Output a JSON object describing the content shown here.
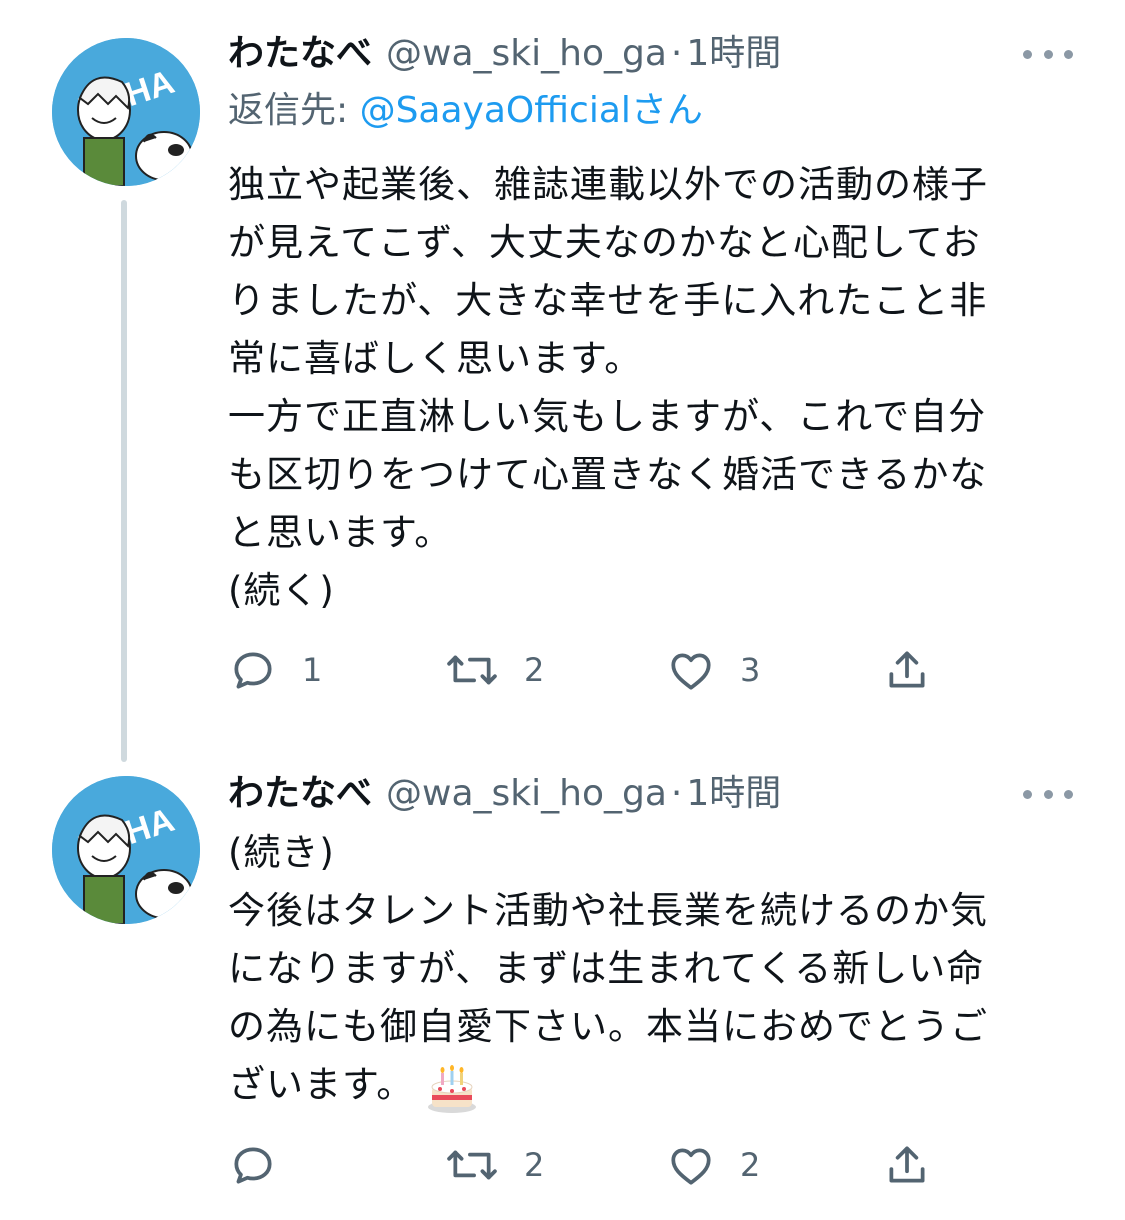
{
  "tweets": [
    {
      "display_name": "わたなべ",
      "handle": "@wa_ski_ho_ga",
      "separator": "·",
      "time": "1時間",
      "reply_prefix": "返信先: ",
      "reply_mention": "@SaayaOfficial",
      "reply_suffix": "さん",
      "lines": [
        "独立や起業後、雑誌連載以外での活動の様子",
        "が見えてこず、大丈夫なのかなと心配してお",
        "りましたが、大きな幸せを手に入れたこと非",
        "常に喜ばしく思います。",
        "一方で正直淋しい気もしますが、これで自分",
        "も区切りをつけて心置きなく婚活できるかな",
        "と思います。",
        "(続く)"
      ],
      "reply_count": "1",
      "retweet_count": "2",
      "like_count": "3",
      "avatar_text": "HAHA"
    },
    {
      "display_name": "わたなべ",
      "handle": "@wa_ski_ho_ga",
      "separator": "·",
      "time": "1時間",
      "lines": [
        "(続き)",
        "今後はタレント活動や社長業を続けるのか気",
        "になりますが、まずは生まれてくる新しい命",
        "の為にも御自愛下さい。本当におめでとうご",
        "ざいます。"
      ],
      "reply_count": "",
      "retweet_count": "2",
      "like_count": "2",
      "avatar_text": "HAHA"
    }
  ],
  "colors": {
    "text": "#0f1419",
    "secondary": "#536471",
    "link": "#1d9bf0",
    "thread_line": "#cfd9de",
    "avatar_bg": "#49a9dc"
  },
  "icons": {
    "reply": "speech-bubble-icon",
    "retweet": "retweet-arrows-icon",
    "like": "heart-icon",
    "share": "share-upload-icon",
    "more": "more-dots-icon",
    "emoji": "birthday-cake-emoji"
  }
}
